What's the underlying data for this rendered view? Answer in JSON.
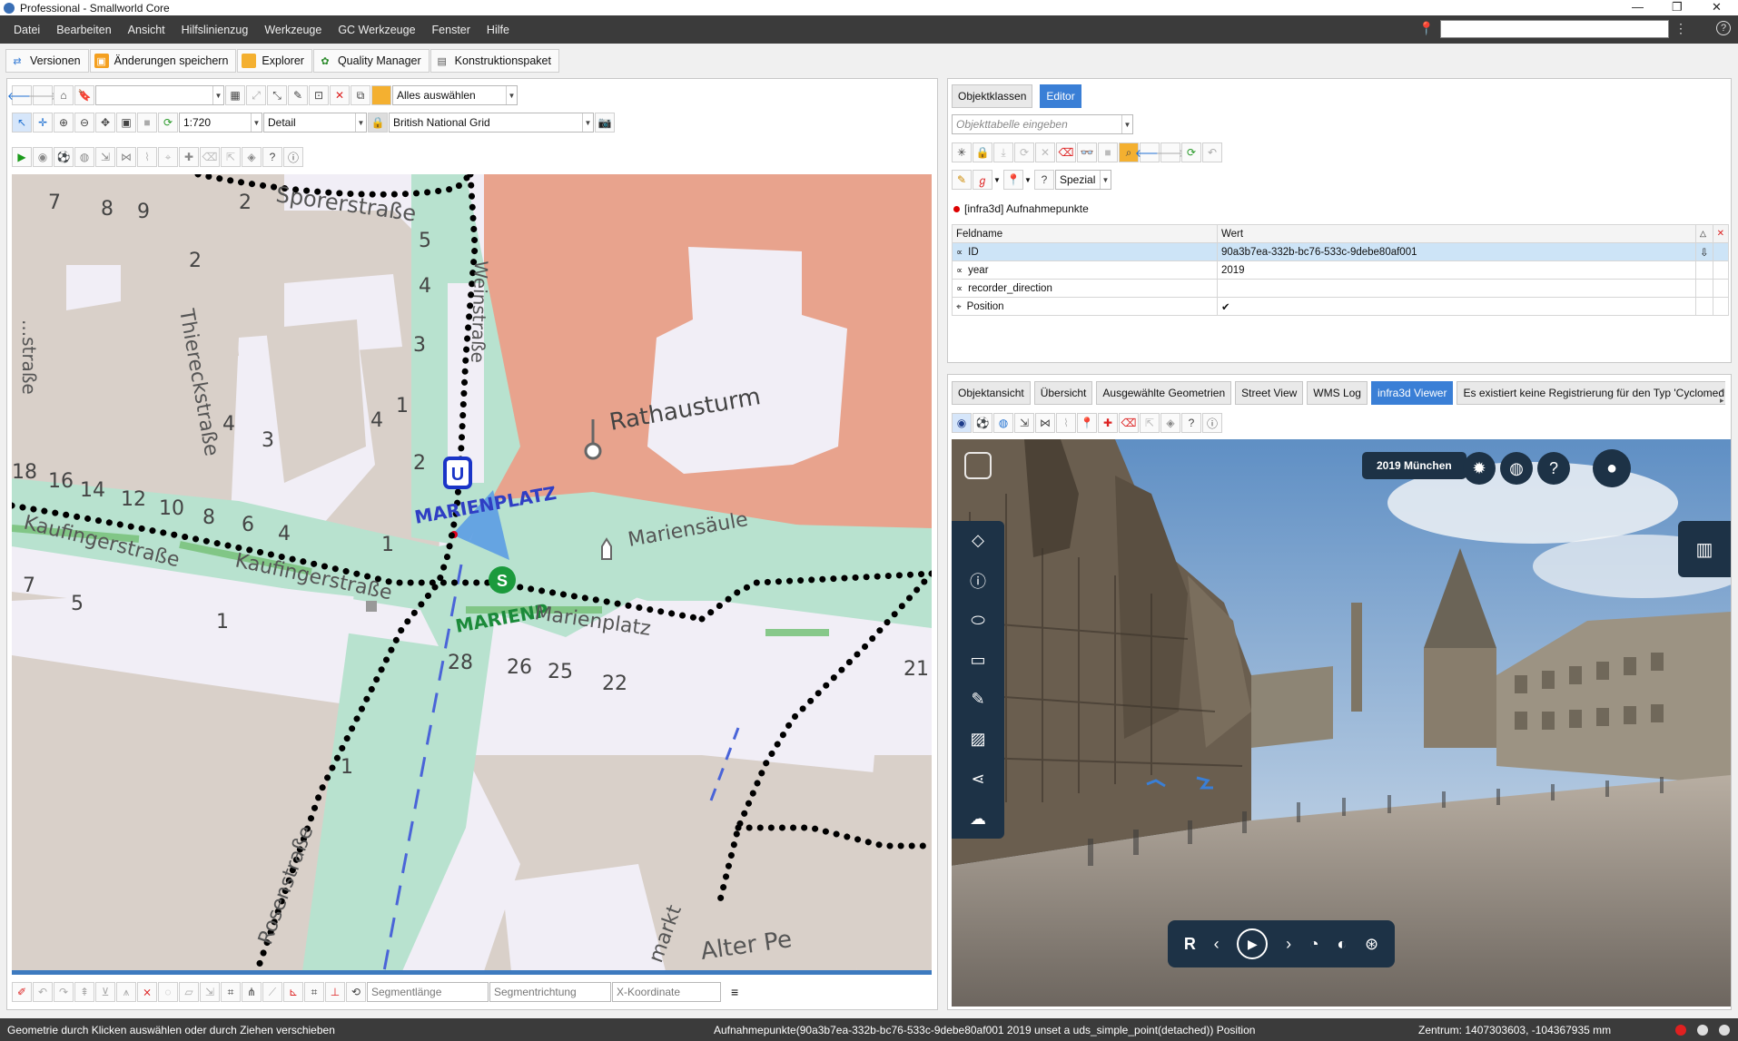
{
  "window": {
    "title": "Professional - Smallworld Core"
  },
  "menu": [
    "Datei",
    "Bearbeiten",
    "Ansicht",
    "Hilfslinienzug",
    "Werkzeuge",
    "GC Werkzeuge",
    "Fenster",
    "Hilfe"
  ],
  "toolbar": {
    "items": [
      "Versionen",
      "Änderungen speichern",
      "Explorer",
      "Quality Manager",
      "Konstruktionspaket"
    ]
  },
  "map_toolbar": {
    "select_all": "Alles auswählen",
    "scale": "1:720",
    "detail": "Detail",
    "crs": "British National Grid"
  },
  "map_labels": {
    "sporerstrasse": "Sporerstraße",
    "thiereckstrasse": "Thiereckstraße",
    "weinstrasse": "Weinstraße",
    "rathausturm": "Rathausturm",
    "marienplatz_station": "MARIENPLATZ",
    "mariensaeule": "Mariensäule",
    "kaufingerstrasse1": "Kaufingerstraße",
    "kaufingerstrasse2": "Kaufingerstraße",
    "marienplatz_green": "MARIENP",
    "marienplatz_street": "Marienplatz",
    "rosenstrasse": "Rosenstraße",
    "markt": "markt",
    "alter_peter": "Alter Pe",
    "left_edge": "...straße",
    "numbers": [
      "7",
      "8",
      "9",
      "2",
      "5",
      "4",
      "2",
      "3",
      "1",
      "4",
      "4",
      "3",
      "2",
      "18",
      "16",
      "14",
      "12",
      "10",
      "8",
      "6",
      "4",
      "1",
      "7",
      "5",
      "1",
      "28",
      "26",
      "25",
      "22",
      "21",
      "1"
    ]
  },
  "map_bottom": {
    "segmentlaenge": "Segmentlänge",
    "segmentrichtung": "Segmentrichtung",
    "xkoord": "X-Koordinate"
  },
  "right_top": {
    "tabs": [
      "Objektklassen",
      "Editor"
    ],
    "active_tab": "Editor",
    "table_input_placeholder": "Objekttabelle eingeben",
    "mode": "Spezial",
    "object_title": "[infra3d] Aufnahmepunkte",
    "columns": [
      "Feldname",
      "Wert"
    ],
    "rows": [
      {
        "name": "ID",
        "value": "90a3b7ea-332b-bc76-533c-9debe80af001"
      },
      {
        "name": "year",
        "value": "2019"
      },
      {
        "name": "recorder_direction",
        "value": ""
      },
      {
        "name": "Position",
        "value": "✔"
      }
    ]
  },
  "right_bottom": {
    "tabs": [
      "Objektansicht",
      "Übersicht",
      "Ausgewählte Geometrien",
      "Street View",
      "WMS Log",
      "infra3d Viewer",
      "Es existiert keine Registrierung für den Typ 'Cyclomed"
    ],
    "active_tab": "infra3d Viewer"
  },
  "viewer": {
    "badge": "2019 München",
    "controls": {
      "r": "R"
    }
  },
  "status": {
    "left": "Geometrie durch Klicken auswählen oder durch Ziehen verschieben",
    "center": "Aufnahmepunkte(90a3b7ea-332b-bc76-533c-9debe80af001 2019 unset a uds_simple_point(detached)) Position",
    "right": "Zentrum: 1407303603, -104367935 mm"
  },
  "colors": {
    "menubar": "#3b3b3b",
    "accent": "#3a7fd6",
    "map_green": "#b8e2cf",
    "map_building": "#d9d0c9",
    "map_red": "#e8a38d",
    "viewer_nav": "#1d3246"
  }
}
